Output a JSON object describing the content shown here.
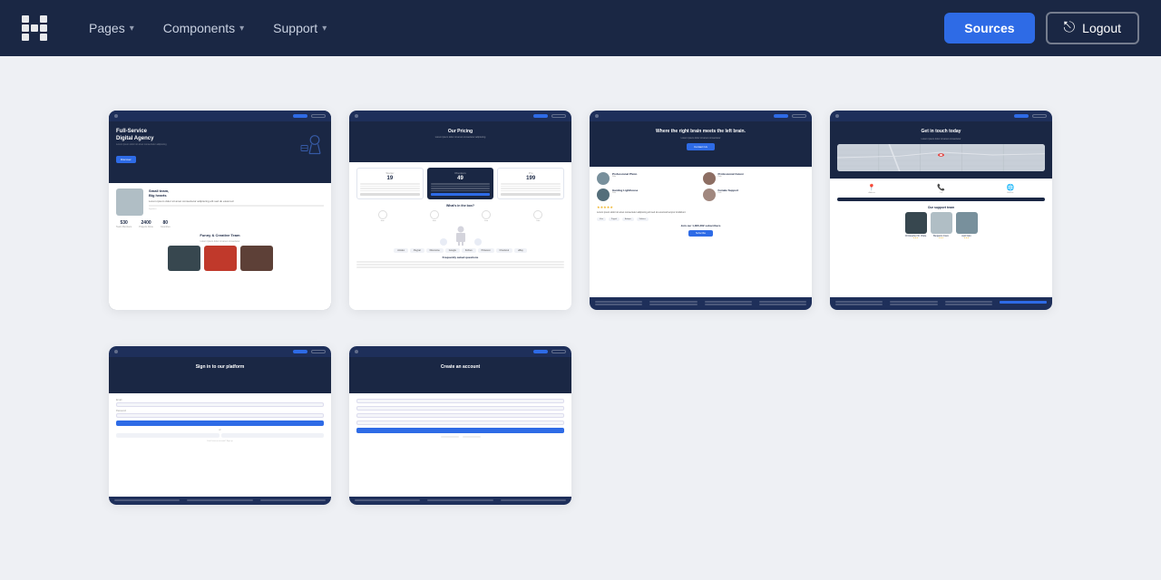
{
  "navbar": {
    "logo_alt": "App Logo",
    "nav_items": [
      {
        "label": "Pages",
        "id": "pages"
      },
      {
        "label": "Components",
        "id": "components"
      },
      {
        "label": "Support",
        "id": "support"
      }
    ],
    "sources_label": "Sources",
    "logout_label": "Logout"
  },
  "cards_row1": [
    {
      "id": "agency",
      "preview_type": "agency",
      "hero_title": "Full-Service\nDigital Agency",
      "team_section_title": "Small team,\nBig hearts",
      "stats": [
        {
          "num": "530",
          "label": "Team Members"
        },
        {
          "num": "2400",
          "label": "Projects Done"
        },
        {
          "num": "80",
          "label": "Countries"
        }
      ],
      "creative_team_label": "Funny & Creative Team",
      "portraits": [
        "person1",
        "person2",
        "person3"
      ]
    },
    {
      "id": "pricing",
      "preview_type": "pricing",
      "hero_title": "Our Pricing",
      "pricing_plans": [
        {
          "name": "Starter",
          "price": "19",
          "featured": false
        },
        {
          "name": "Premium",
          "price": "49",
          "featured": true
        },
        {
          "name": "Pro",
          "price": "199",
          "featured": false
        }
      ],
      "whats_included_label": "What's in the box?",
      "faq_label": "Frequently asked questions"
    },
    {
      "id": "support",
      "preview_type": "support",
      "hero_title": "Where the right brain meets the left brain.",
      "hero_btn_label": "Contact Us",
      "team_members": [
        {
          "name": "Professional Photo",
          "role": ""
        },
        {
          "name": "Professional Cutest",
          "role": ""
        },
        {
          "name": "Guiding Lighthouse",
          "role": ""
        },
        {
          "name": "Female Support",
          "role": ""
        }
      ],
      "stars": "★★★★★",
      "sub_count": "Join our 1,360,462 subscribers",
      "payment_logos": [
        "Visa",
        "Paypal",
        "Antique",
        "Feifeico"
      ]
    },
    {
      "id": "contact",
      "preview_type": "contact",
      "hero_title": "Get in touch today",
      "icons": [
        {
          "sym": "📍",
          "label": "Address"
        },
        {
          "sym": "📞",
          "label": "Call"
        },
        {
          "sym": "🌐",
          "label": "Website"
        }
      ],
      "team_label": "Our support team",
      "team_portraits": [
        "portrait1",
        "portrait2",
        "portrait3"
      ]
    }
  ],
  "cards_row2": [
    {
      "id": "login",
      "preview_type": "login",
      "hero_title": "Sign in to our platform",
      "fields": [
        "Email",
        "Password"
      ],
      "btn_label": "Login",
      "or_label": "or",
      "social_options": [
        "Google",
        "Facebook"
      ],
      "bottom_text": "Don't have an account? Sign up"
    },
    {
      "id": "register",
      "preview_type": "register",
      "hero_title": "Create an account",
      "fields": [
        "Your name",
        "Email",
        "Password",
        "Confirm password"
      ],
      "btn_label": "Create account",
      "bottom_text": "Already have an account? Login"
    }
  ],
  "colors": {
    "navy": "#1a2744",
    "blue": "#2e6be6",
    "light_bg": "#eef0f4",
    "white": "#ffffff"
  }
}
